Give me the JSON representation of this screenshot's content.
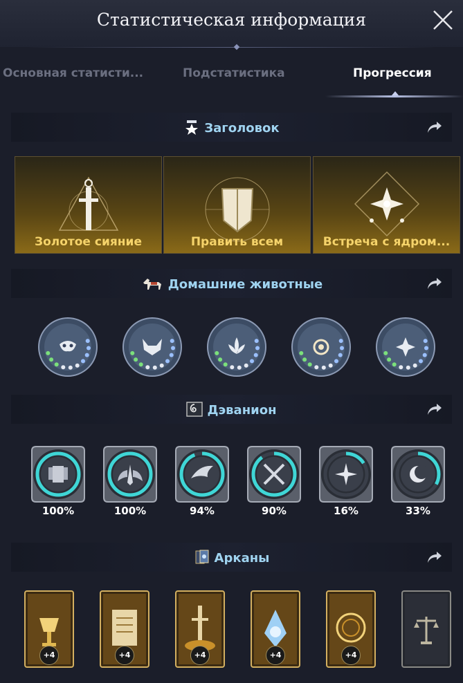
{
  "window": {
    "title": "Статистическая информация"
  },
  "tabs": [
    {
      "label": "Основная статисти...",
      "active": false
    },
    {
      "label": "Подстатистика",
      "active": false
    },
    {
      "label": "Прогрессия",
      "active": true
    }
  ],
  "sections": {
    "titles": {
      "label": "Заголовок",
      "cards": [
        {
          "label": "Золотое сияние",
          "icon": "sword-triangle-emblem"
        },
        {
          "label": "Править всем",
          "icon": "shield-emblem"
        },
        {
          "label": "Встреча с ядром...",
          "icon": "star-diamond-emblem"
        }
      ]
    },
    "pets": {
      "label": "Домашние животные",
      "items": [
        {
          "icon": "mask-emblem"
        },
        {
          "icon": "fox-emblem"
        },
        {
          "icon": "lotus-emblem"
        },
        {
          "icon": "vortex-emblem"
        },
        {
          "icon": "flower-emblem"
        }
      ]
    },
    "devanion": {
      "label": "Дэванион",
      "items": [
        {
          "icon": "armor-emblem",
          "progress": 1.0,
          "percent_text": "100%"
        },
        {
          "icon": "wings-emblem",
          "progress": 1.0,
          "percent_text": "100%"
        },
        {
          "icon": "bird-emblem",
          "progress": 0.94,
          "percent_text": "94%"
        },
        {
          "icon": "crossed-swords-emblem",
          "progress": 0.9,
          "percent_text": "90%"
        },
        {
          "icon": "radiant-star-emblem",
          "progress": 0.16,
          "percent_text": "16%"
        },
        {
          "icon": "crescent-emblem",
          "progress": 0.33,
          "percent_text": "33%"
        }
      ]
    },
    "arcana": {
      "label": "Арканы",
      "cards": [
        {
          "icon": "chalice-card",
          "badge": "+4"
        },
        {
          "icon": "scroll-card",
          "badge": "+4"
        },
        {
          "icon": "sword-card",
          "badge": "+4"
        },
        {
          "icon": "crystal-card",
          "badge": "+4"
        },
        {
          "icon": "ring-card",
          "badge": "+4"
        },
        {
          "icon": "scales-card",
          "badge": ""
        }
      ]
    }
  },
  "colors": {
    "background": "#1b1e2a",
    "section_title": "#9fd3f0",
    "gold_text": "#f5d36a",
    "progress_ring": "#3fd6d6"
  }
}
